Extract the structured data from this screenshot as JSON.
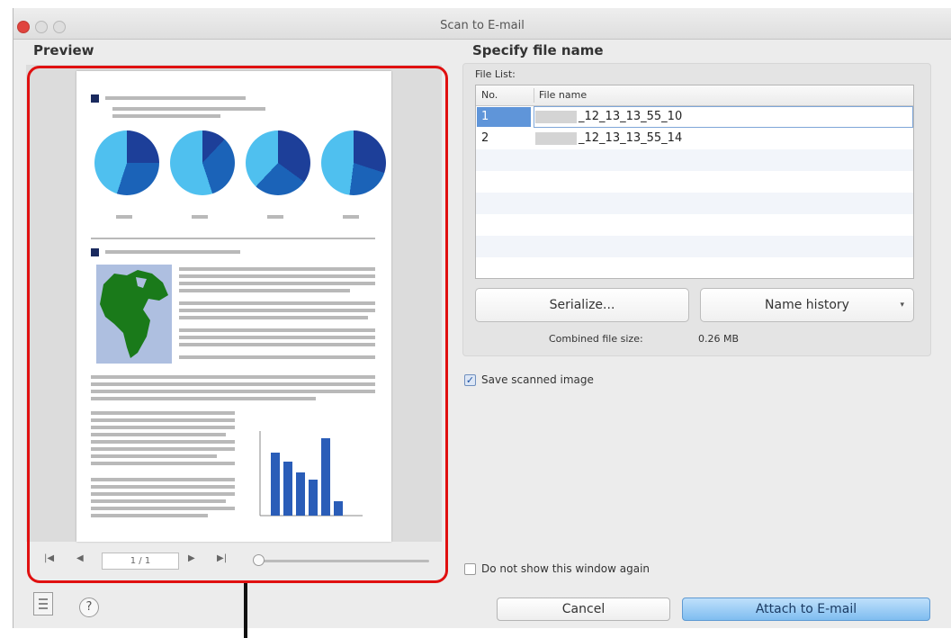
{
  "window": {
    "title": "Scan to E-mail"
  },
  "preview": {
    "section_title": "Preview",
    "page_indicator": "1 / 1",
    "zoom_level": 0.0
  },
  "file_name": {
    "section_title": "Specify file name",
    "file_list_label": "File List:",
    "columns": [
      "No.",
      "File name"
    ],
    "rows": [
      {
        "no": "1",
        "name": "_12_13_13_55_10"
      },
      {
        "no": "2",
        "name": "_12_13_13_55_14"
      }
    ],
    "serialize_label": "Serialize...",
    "name_history_label": "Name history",
    "combined_size_label": "Combined file size:",
    "combined_size_value": "0.26 MB"
  },
  "options": {
    "save_scanned_image": {
      "label": "Save scanned image",
      "checked": true
    },
    "do_not_show_again": {
      "label": "Do not show this window again",
      "checked": false
    }
  },
  "actions": {
    "cancel_label": "Cancel",
    "attach_label": "Attach to E-mail"
  },
  "icons": {
    "close": "close-icon",
    "minimize": "minimize-icon",
    "zoom": "zoom-icon",
    "first_page": "first-page-icon",
    "prev_page": "previous-page-icon",
    "next_page": "next-page-icon",
    "last_page": "last-page-icon",
    "tools": "document-list-icon",
    "help": "help-icon"
  },
  "colors": {
    "highlight_border": "#e01010",
    "selection": "#5f95d9",
    "primary_button": "#7fbdf0"
  }
}
